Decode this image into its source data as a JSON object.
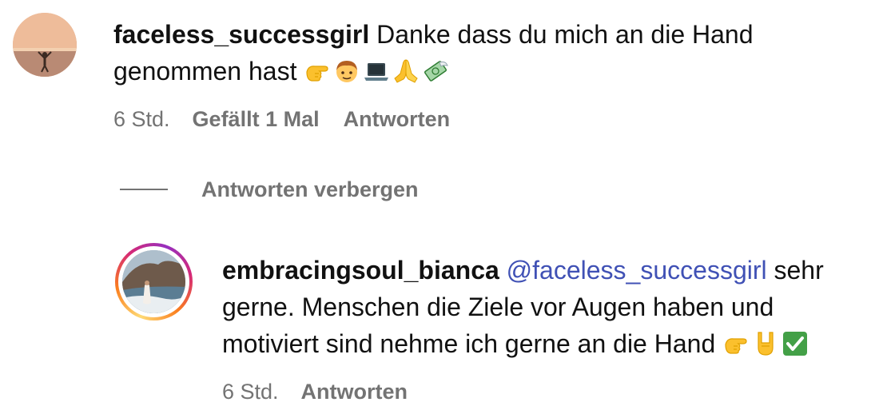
{
  "comment": {
    "username": "faceless_successgirl",
    "text": "Danke dass du mich an die Hand genommen hast",
    "emojis": [
      "pointing-hand-emoji",
      "boy-emoji",
      "laptop-emoji",
      "folded-hands-emoji",
      "money-wings-emoji"
    ],
    "time": "6 Std.",
    "likes": "Gefällt 1 Mal",
    "reply_label": "Antworten"
  },
  "hide_replies_label": "Antworten verbergen",
  "reply": {
    "username": "embracingsoul_bianca",
    "mention": "@faceless_successgirl",
    "text": "sehr gerne. Menschen die Ziele vor Augen haben und motiviert sind nehme ich gerne an die Hand",
    "emojis": [
      "pointing-hand-emoji",
      "rock-on-hand-emoji",
      "check-mark-button-emoji"
    ],
    "time": "6 Std.",
    "reply_label": "Antworten"
  },
  "colors": {
    "text": "#111111",
    "secondary": "#737373",
    "mention": "#4051b5",
    "story_ring": [
      "#feda75",
      "#fa7e1e",
      "#d62976",
      "#962fbf"
    ]
  }
}
